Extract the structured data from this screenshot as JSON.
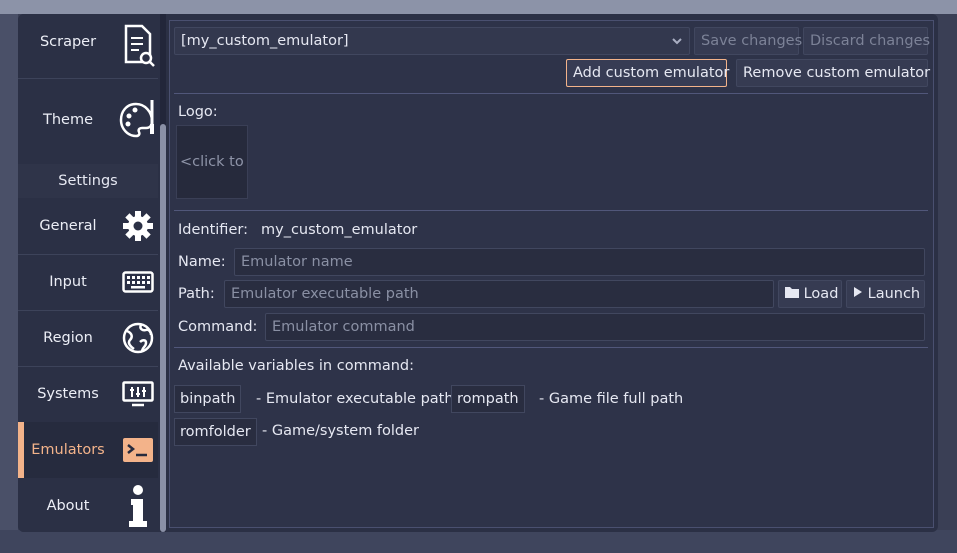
{
  "sidebar": {
    "items": [
      {
        "label": "Scraper",
        "icon": "scraper-icon"
      },
      {
        "label": "Theme",
        "icon": "palette-icon"
      }
    ],
    "section_title": "Settings",
    "settings_items": [
      {
        "label": "General",
        "icon": "gear-icon"
      },
      {
        "label": "Input",
        "icon": "keyboard-icon"
      },
      {
        "label": "Region",
        "icon": "globe-icon"
      },
      {
        "label": "Systems",
        "icon": "system-icon"
      },
      {
        "label": "Emulators",
        "icon": "terminal-icon",
        "active": true
      },
      {
        "label": "About",
        "icon": "info-icon"
      }
    ]
  },
  "toolbar": {
    "emulator_select_value": "[my_custom_emulator]",
    "save_label": "Save changes",
    "discard_label": "Discard changes",
    "add_label": "Add custom emulator",
    "remove_label": "Remove custom emulator"
  },
  "form": {
    "logo_label": "Logo:",
    "logo_placeholder": "<click to",
    "identifier_label": "Identifier:",
    "identifier_value": "my_custom_emulator",
    "name_label": "Name:",
    "name_placeholder": "Emulator name",
    "path_label": "Path:",
    "path_placeholder": "Emulator executable path",
    "load_label": "Load",
    "launch_label": "Launch",
    "command_label": "Command:",
    "command_placeholder": "Emulator command"
  },
  "variables": {
    "title": "Available variables in command:",
    "items": [
      {
        "name": "binpath",
        "desc": "- Emulator executable path"
      },
      {
        "name": "rompath",
        "desc": "- Game file full path"
      },
      {
        "name": "romfolder",
        "desc": "- Game/system folder"
      }
    ]
  },
  "colors": {
    "accent": "#f3b38a",
    "panel": "#2e3349",
    "sidebar": "#2b3045"
  }
}
